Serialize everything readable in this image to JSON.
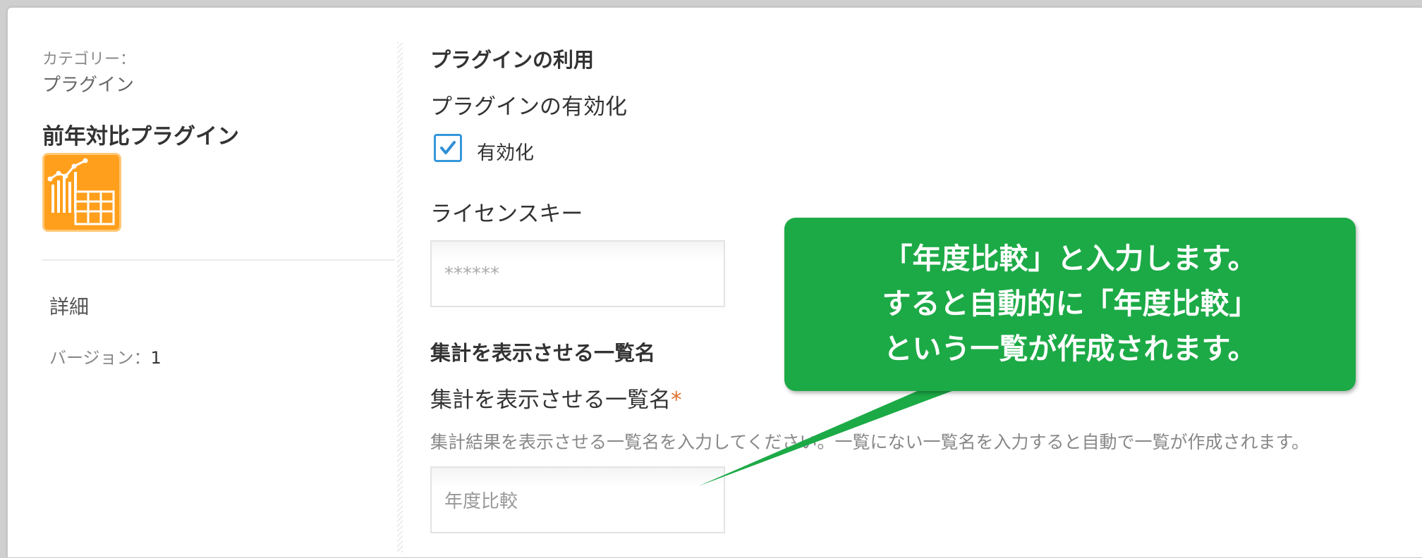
{
  "sidebar": {
    "category_label": "カテゴリー：",
    "category_value": "プラグイン",
    "plugin_name": "前年対比プラグイン",
    "plugin_icon": "chart-table-icon",
    "detail_label": "詳細",
    "version_label": "バージョン：",
    "version_value": "1"
  },
  "main": {
    "section_usage_title": "プラグインの利用",
    "enable_label": "プラグインの有効化",
    "enable_checkbox_label": "有効化",
    "enable_checked": true,
    "license_label": "ライセンスキー",
    "license_value": "******",
    "list_section_title": "集計を表示させる一覧名",
    "list_field_label": "集計を表示させる一覧名",
    "required_mark": "*",
    "list_help_text": "集計結果を表示させる一覧名を入力してください。一覧にない一覧名を入力すると自動で一覧が作成されます。",
    "list_value": "年度比較"
  },
  "callout": {
    "lines": [
      "「年度比較」と入力します。",
      "すると自動的に「年度比較」",
      "という一覧が作成されます。"
    ]
  },
  "colors": {
    "accent_blue": "#3498db",
    "callout_green": "#1caa46",
    "icon_orange": "#ff9f1c",
    "required_orange": "#e0732d"
  }
}
